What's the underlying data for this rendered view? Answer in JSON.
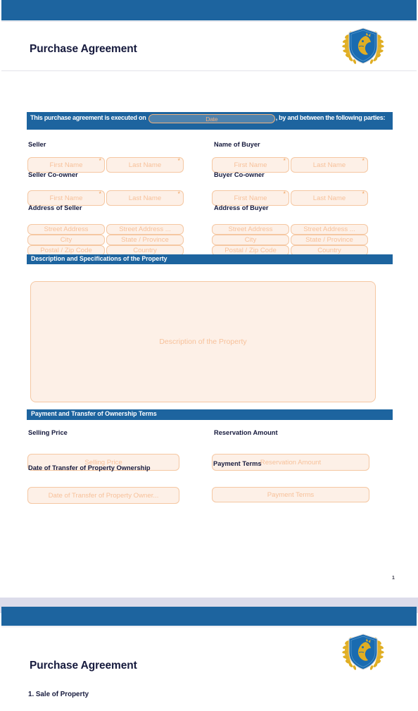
{
  "document": {
    "title": "Purchase Agreement",
    "logo_icon": "shield-horse-laurel-emblem",
    "page_number": "1"
  },
  "theme": {
    "band_blue": "#1d649f",
    "field_fill": "#fdf0e7",
    "field_border": "#f5c7a2",
    "field_placeholder": "#f7c19a",
    "label_color": "#161a3d",
    "required_marker": "*",
    "gap_band": "#dcdcea"
  },
  "intro": {
    "text_before_date": "This purchase agreement is executed on ",
    "date_placeholder": "Date",
    "underscores": "______________________________",
    "text_after_date": ", by and between the following parties:"
  },
  "parties": {
    "seller": {
      "name_label": "Seller",
      "coowner_label": "Seller Co-owner",
      "address_label": "Address of Seller",
      "first_name_placeholder": "First Name",
      "last_name_placeholder": "Last Name",
      "co_first_name_placeholder": "First Name",
      "co_last_name_placeholder": "Last Name",
      "address": {
        "street": "Street Address",
        "street2": "Street Address ...",
        "city": "City",
        "state": "State / Province",
        "postal": "Postal / Zip Code",
        "country": "Country"
      }
    },
    "buyer": {
      "name_label": "Name of Buyer",
      "coowner_label": "Buyer Co-owner",
      "address_label": "Address of Buyer",
      "first_name_placeholder": "First Name",
      "last_name_placeholder": "Last Name",
      "co_first_name_placeholder": "First Name",
      "co_last_name_placeholder": "Last Name",
      "address": {
        "street": "Street Address",
        "street2": "Street Address ...",
        "city": "City",
        "state": "State / Province",
        "postal": "Postal / Zip Code",
        "country": "Country"
      }
    }
  },
  "description_section": {
    "bar_label": "Description and Specifications of the Property",
    "textarea_placeholder": "Description of the Property"
  },
  "payment_section": {
    "bar_label": "Payment and Transfer of Ownership Terms",
    "selling_price_label": "Selling Price",
    "selling_price_placeholder": "Selling Price",
    "reservation_label": "Reservation Amount",
    "reservation_placeholder": "Reservation Amount",
    "transfer_date_label": "Date of Transfer of Property Ownership",
    "transfer_date_placeholder": "Date of Transfer of Property Owner...",
    "payment_terms_label": "Payment Terms",
    "payment_terms_placeholder": "Payment Terms"
  },
  "page_two": {
    "title": "Purchase Agreement",
    "section_heading": "1. Sale of Property",
    "logo_icon": "shield-horse-laurel-emblem"
  }
}
